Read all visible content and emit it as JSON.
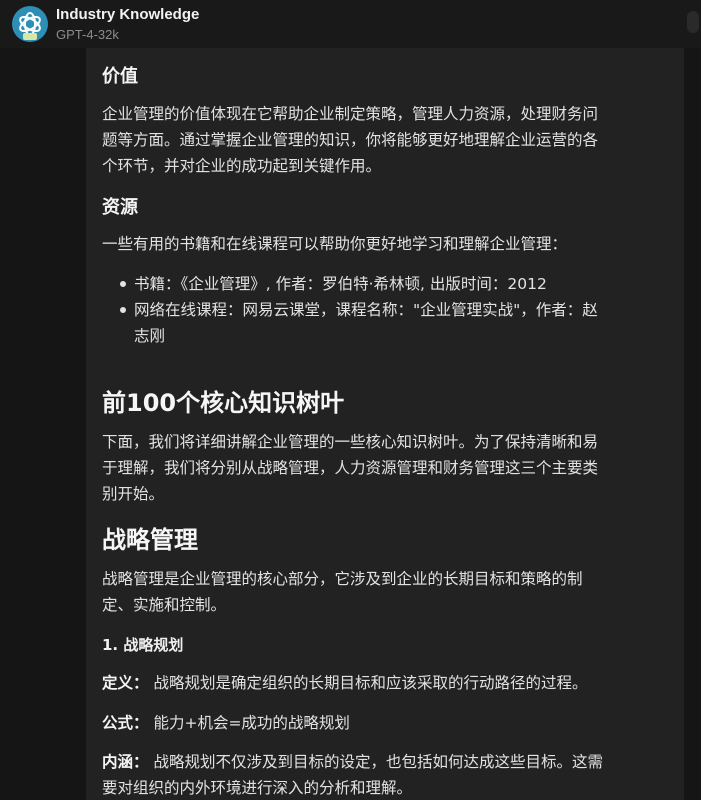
{
  "header": {
    "title": "Industry Knowledge",
    "subtitle": "GPT-4-32k"
  },
  "content": {
    "value_heading": "价值",
    "value_para": [
      "企业管理的价值体现在它帮助企业制定策略，管理人力资源，处理财务问",
      "题等方面。通过掌握企业管理的知识，你将能够更好地理解企业运营的各",
      "个环节，并对企业的成功起到关键作用。"
    ],
    "resources_heading": "资源",
    "resources_intro": "一些有用的书籍和在线课程可以帮助你更好地学习和理解企业管理：",
    "resources_items": [
      {
        "lines": [
          "书籍：《企业管理》, 作者：罗伯特·希林顿, 出版时间：2012"
        ]
      },
      {
        "lines": [
          "网络在线课程：网易云课堂，课程名称：\"企业管理实战\"，作者：赵",
          "志刚"
        ]
      }
    ],
    "core_heading": "前100个核心知识树叶",
    "core_para": [
      "下面，我们将详细讲解企业管理的一些核心知识树叶。为了保持清晰和易",
      "于理解，我们将分别从战略管理，人力资源管理和财务管理这三个主要类",
      "别开始。"
    ],
    "strategy_heading": "战略管理",
    "strategy_para": [
      "战略管理是企业管理的核心部分，它涉及到企业的长期目标和策略的制",
      "定、实施和控制。"
    ],
    "planning_heading": "1. 战略规划",
    "definition_label": "定义：",
    "definition_text": "战略规划是确定组织的长期目标和应该采取的行动路径的过程。",
    "formula_label": "公式：",
    "formula_text": "能力+机会=成功的战略规划",
    "connotation_label": "内涵：",
    "connotation_line1": "战略规划不仅涉及到目标的设定，也包括如何达成这些目标。这需",
    "connotation_line2": "要对组织的内外环境进行深入的分析和理解。"
  }
}
